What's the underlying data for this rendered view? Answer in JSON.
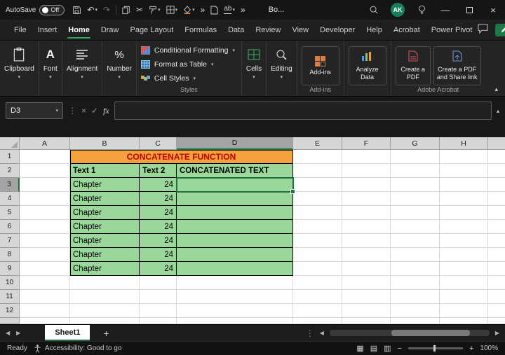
{
  "colors": {
    "accent_green": "#2fa763",
    "selection_green": "#1d7044",
    "table_green": "#9bd79b",
    "table_orange": "#f2a13c",
    "title_red": "#c00000"
  },
  "icons": {
    "caret_down": "▾",
    "caret_up": "▴",
    "undo": "↶",
    "redo": "↷",
    "cut": "✂",
    "chevrons": "»",
    "dots_v": "⋮",
    "close": "×",
    "check": "✓",
    "left_arrow": "◀",
    "right_arrow": "▶",
    "plus": "+",
    "minus": "−",
    "min_glyph": "—",
    "font_glyph": "A",
    "percent": "%",
    "ab": "ab",
    "view_normal": "▦",
    "view_layout": "▤",
    "view_break": "▥"
  },
  "titlebar": {
    "autosave": "AutoSave",
    "autosave_state": "Off",
    "doc_title": "Bo...",
    "avatar": "AK"
  },
  "tabs": {
    "items": [
      "File",
      "Insert",
      "Home",
      "Draw",
      "Page Layout",
      "Formulas",
      "Data",
      "Review",
      "View",
      "Developer",
      "Help",
      "Acrobat",
      "Power Pivot"
    ],
    "active": "Home"
  },
  "ribbon": {
    "clipboard": "Clipboard",
    "font": "Font",
    "alignment": "Alignment",
    "number": "Number",
    "conditional_formatting": "Conditional Formatting",
    "format_as_table": "Format as Table",
    "cell_styles": "Cell Styles",
    "styles_group": "Styles",
    "cells": "Cells",
    "editing": "Editing",
    "addins": "Add-ins",
    "addins_group": "Add-ins",
    "analyze_data": "Analyze Data",
    "create_pdf": "Create a PDF",
    "create_pdf_share": "Create a PDF and Share link",
    "acrobat_group": "Adobe Acrobat"
  },
  "formula_bar": {
    "name_box": "D3",
    "fx": "fx",
    "formula": ""
  },
  "grid": {
    "columns": [
      "A",
      "B",
      "C",
      "D",
      "E",
      "F",
      "G",
      "H"
    ],
    "rows": [
      "1",
      "2",
      "3",
      "4",
      "5",
      "6",
      "7",
      "8",
      "9",
      "10",
      "11",
      "12"
    ],
    "selected_cell": "D3",
    "title": "CONCATENATE FUNCTION",
    "header_text1": "Text 1",
    "header_text2": "Text 2",
    "header_concat": "CONCATENATED TEXT",
    "data_rows": [
      {
        "text1": "Chapter",
        "text2": "24",
        "concat": ""
      },
      {
        "text1": "Chapter",
        "text2": "24",
        "concat": ""
      },
      {
        "text1": "Chapter",
        "text2": "24",
        "concat": ""
      },
      {
        "text1": "Chapter",
        "text2": "24",
        "concat": ""
      },
      {
        "text1": "Chapter",
        "text2": "24",
        "concat": ""
      },
      {
        "text1": "Chapter",
        "text2": "24",
        "concat": ""
      },
      {
        "text1": "Chapter",
        "text2": "24",
        "concat": ""
      }
    ]
  },
  "sheet_bar": {
    "tab": "Sheet1"
  },
  "status_bar": {
    "ready": "Ready",
    "accessibility": "Accessibility: Good to go",
    "zoom": "100%"
  }
}
